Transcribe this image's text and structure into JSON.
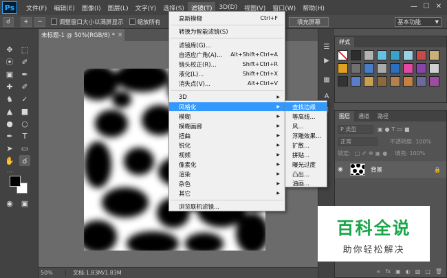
{
  "app": {
    "logo": "Ps"
  },
  "menubar": {
    "items": [
      "文件(F)",
      "编辑(E)",
      "图像(I)",
      "图层(L)",
      "文字(Y)",
      "选择(S)",
      "滤镜(T)",
      "3D(D)",
      "视图(V)",
      "窗口(W)",
      "帮助(H)"
    ],
    "active_index": 6,
    "win_controls": [
      "—",
      "☐",
      "✕"
    ]
  },
  "options_bar": {
    "tool_icon": "zoom-icon",
    "checkbox1": "调整窗口大小以满屏显示",
    "checkbox2": "缩放所有",
    "fill_screen": "填充屏幕",
    "workspace": "基本功能"
  },
  "document": {
    "tab_title": "未标题-1 @ 50%(RGB/8) *",
    "zoom": "50%",
    "doc_size": "文档:1.83M/1.83M"
  },
  "filter_menu": {
    "last_filter": {
      "label": "高斯模糊",
      "shortcut": "Ctrl+F"
    },
    "smart": "转换为智能滤镜(S)",
    "group1": [
      {
        "label": "滤镜库(G)...",
        "shortcut": ""
      },
      {
        "label": "自适应广角(A)...",
        "shortcut": "Alt+Shift+Ctrl+A"
      },
      {
        "label": "镜头校正(R)...",
        "shortcut": "Shift+Ctrl+R"
      },
      {
        "label": "液化(L)...",
        "shortcut": "Shift+Ctrl+X"
      },
      {
        "label": "消失点(V)...",
        "shortcut": "Alt+Ctrl+V"
      }
    ],
    "submenus": [
      "3D",
      "风格化",
      "模糊",
      "模糊画廊",
      "扭曲",
      "锐化",
      "视频",
      "像素化",
      "渲染",
      "杂色",
      "其它"
    ],
    "highlighted_submenu": 1,
    "browse": "浏览联机滤镜..."
  },
  "stylize_menu": {
    "items": [
      "查找边缘",
      "等高线...",
      "风...",
      "浮雕效果...",
      "扩散...",
      "拼贴...",
      "曝光过度",
      "凸出...",
      "油画..."
    ],
    "highlighted_index": 0
  },
  "styles_panel": {
    "tab": "样式",
    "swatch_colors": [
      "#ffffff",
      "#2d2d2d",
      "#b3b3b3",
      "#66c2e0",
      "#3aa3c9",
      "#9bd0e6",
      "#c64a4a",
      "#c8b078",
      "#e0a020",
      "#707070",
      "#4a7cc7",
      "#aaaaaa",
      "#2c6fbf",
      "#e04aa0",
      "#8844aa",
      "#d0d0d0",
      "#333333",
      "#5a7dc9",
      "#c8a050",
      "#8c6a3a",
      "#b38050",
      "#c88040",
      "#6a6aa0",
      "#a04aa0"
    ]
  },
  "layers_panel": {
    "tabs": [
      "图层",
      "通道",
      "路径"
    ],
    "active_tab": 0,
    "kind": "P 类型",
    "blend": "正常",
    "opacity": "不透明度: 100%",
    "lock": "锁定:",
    "fill": "填充: 100%",
    "layer_name": "背景"
  },
  "watermark": {
    "title": "百科全说",
    "subtitle": "助你轻松解决"
  }
}
